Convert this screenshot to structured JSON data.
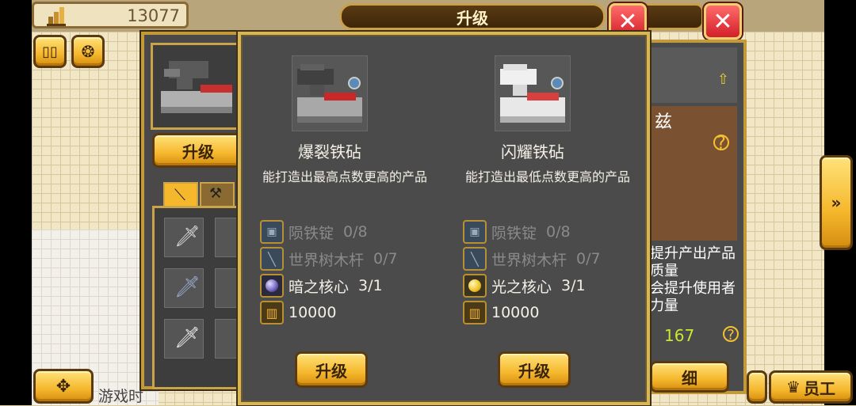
{
  "top_bar": {
    "gold_count": "13077"
  },
  "dialog": {
    "title": "升级",
    "options": [
      {
        "name": "爆裂铁砧",
        "desc": "能打造出最高点数更高的产品",
        "requirements": [
          {
            "icon": "ingot-icon",
            "name": "陨铁锭",
            "count": "0/8",
            "met": false
          },
          {
            "icon": "wood-rod-icon",
            "name": "世界树木杆",
            "count": "0/7",
            "met": false
          },
          {
            "icon": "dark-core-icon",
            "name": "暗之核心",
            "count": "3/1",
            "met": true
          },
          {
            "icon": "gold-icon",
            "name": "",
            "count": "10000",
            "met": true
          }
        ],
        "button_label": "升级"
      },
      {
        "name": "闪耀铁砧",
        "desc": "能打造出最低点数更高的产品",
        "requirements": [
          {
            "icon": "ingot-icon",
            "name": "陨铁锭",
            "count": "0/8",
            "met": false
          },
          {
            "icon": "wood-rod-icon",
            "name": "世界树木杆",
            "count": "0/7",
            "met": false
          },
          {
            "icon": "light-core-icon",
            "name": "光之核心",
            "count": "3/1",
            "met": true
          },
          {
            "icon": "gold-icon",
            "name": "",
            "count": "10000",
            "met": true
          }
        ],
        "button_label": "升级"
      }
    ]
  },
  "back_panel": {
    "upgrade_label": "升级",
    "footer_text": "游戏时"
  },
  "right_panel": {
    "name_fragment": "兹",
    "desc_lines": [
      "提升产出产品",
      "质量",
      "会提升使用者",
      "力量"
    ],
    "stat_value": "167",
    "detail_label": "细"
  },
  "bottom_bar": {
    "staff_label": "员工"
  },
  "colors": {
    "accent_gold": "#f5b72c",
    "panel_gray": "#4b4b4b",
    "close_red": "#d21f2a",
    "green_stat": "#c8e830"
  }
}
